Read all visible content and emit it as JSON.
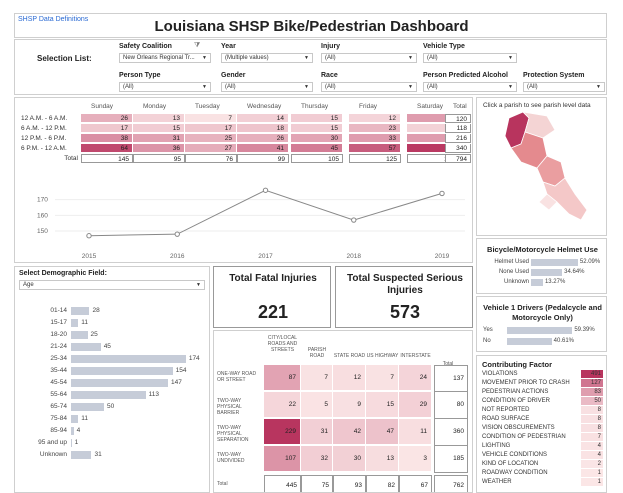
{
  "header": {
    "link": "SHSP Data Definitions",
    "title": "Louisiana SHSP Bike/Pedestrian Dashboard"
  },
  "filters": {
    "selection_label": "Selection List:",
    "safety_coalition": {
      "label": "Safety Coalition",
      "value": "New Orleans Regional Tr..."
    },
    "year": {
      "label": "Year",
      "value": "(Multiple values)"
    },
    "injury": {
      "label": "Injury",
      "value": "(All)"
    },
    "vehicle_type": {
      "label": "Vehicle Type",
      "value": "(All)"
    },
    "person_type": {
      "label": "Person Type",
      "value": "(All)"
    },
    "gender": {
      "label": "Gender",
      "value": "(All)"
    },
    "race": {
      "label": "Race",
      "value": "(All)"
    },
    "alcohol": {
      "label": "Person Predicted Alcohol",
      "value": "(All)"
    },
    "protection": {
      "label": "Protection System",
      "value": "(All)"
    }
  },
  "time_matrix": {
    "columns": [
      "Sunday",
      "Monday",
      "Tuesday",
      "Wednesday",
      "Thursday",
      "Friday",
      "Saturday",
      "Total"
    ],
    "rows": [
      {
        "label": "12 A.M. - 6 A.M.",
        "values": [
          26,
          13,
          7,
          14,
          15,
          12,
          33
        ],
        "total": 120
      },
      {
        "label": "6 A.M. - 12 P.M.",
        "values": [
          17,
          15,
          17,
          18,
          15,
          23,
          13
        ],
        "total": 118
      },
      {
        "label": "12 P.M. - 6 P.M.",
        "values": [
          38,
          31,
          25,
          26,
          30,
          33,
          33
        ],
        "total": 216
      },
      {
        "label": "6 P.M. - 12 A.M.",
        "values": [
          64,
          36,
          27,
          41,
          45,
          57,
          70
        ],
        "total": 340
      }
    ],
    "total_label": "Total",
    "col_totals": [
      145,
      95,
      76,
      99,
      105,
      125,
      149
    ],
    "grand_total": 794
  },
  "chart_data": {
    "type": "line",
    "x": [
      "2015",
      "2016",
      "2017",
      "2018",
      "2019"
    ],
    "y": [
      147,
      148,
      176,
      157,
      174
    ],
    "yticks": [
      150,
      160,
      170
    ],
    "ylim": [
      143,
      180
    ]
  },
  "map": {
    "hint": "Click a parish to see parish level data"
  },
  "helmet": {
    "title": "Bicycle/Motorcycle Helmet Use",
    "rows": [
      {
        "label": "Helmet Used",
        "pct": "52.09%",
        "v": 52.09
      },
      {
        "label": "None Used",
        "pct": "34.64%",
        "v": 34.64
      },
      {
        "label": "Unknown",
        "pct": "13.27%",
        "v": 13.27
      }
    ]
  },
  "drivers": {
    "title": "Vehicle 1 Drivers (Pedalcycle and Motorcycle Only)",
    "rows": [
      {
        "label": "Yes",
        "pct": "59.39%",
        "v": 59.39
      },
      {
        "label": "No",
        "pct": "40.61%",
        "v": 40.61
      }
    ]
  },
  "demographic": {
    "label": "Select Demographic Field:",
    "value": "Age",
    "rows": [
      {
        "label": "01-14",
        "v": 28
      },
      {
        "label": "15-17",
        "v": 11
      },
      {
        "label": "18-20",
        "v": 25
      },
      {
        "label": "21-24",
        "v": 45
      },
      {
        "label": "25-34",
        "v": 174
      },
      {
        "label": "35-44",
        "v": 154
      },
      {
        "label": "45-54",
        "v": 147
      },
      {
        "label": "55-64",
        "v": 113
      },
      {
        "label": "65-74",
        "v": 50
      },
      {
        "label": "75-84",
        "v": 11
      },
      {
        "label": "85-94",
        "v": 4
      },
      {
        "label": "95 and up",
        "v": 1
      },
      {
        "label": "Unknown",
        "v": 31
      }
    ]
  },
  "fatal": {
    "title": "Total Fatal Injuries",
    "value": "221"
  },
  "serious": {
    "title": "Total Suspected Serious Injuries",
    "value": "573"
  },
  "road": {
    "columns": [
      "CITY/LOCAL ROADS AND STREETS",
      "PARISH ROAD",
      "STATE ROAD",
      "US HIGHWAY",
      "INTERSTATE",
      "Total"
    ],
    "rows": [
      {
        "label": "ONE-WAY ROAD OR STREET",
        "values": [
          87,
          7,
          12,
          7,
          24
        ],
        "total": 137
      },
      {
        "label": "TWO-WAY PHYSICAL BARRIER",
        "values": [
          22,
          5,
          9,
          15,
          29
        ],
        "total": 80
      },
      {
        "label": "TWO-WAY PHYSICAL SEPARATION",
        "values": [
          229,
          31,
          42,
          47,
          11
        ],
        "total": 360
      },
      {
        "label": "TWO-WAY UNDIVIDED",
        "values": [
          107,
          32,
          30,
          13,
          3
        ],
        "total": 185
      }
    ],
    "total_label": "Total",
    "col_totals": [
      445,
      75,
      93,
      82,
      67
    ],
    "grand_total": 762
  },
  "factors": {
    "title": "Contributing Factor",
    "rows": [
      {
        "label": "VIOLATIONS",
        "v": 491
      },
      {
        "label": "MOVEMENT PRIOR TO CRASH",
        "v": 127
      },
      {
        "label": "PEDESTRIAN ACTIONS",
        "v": 83
      },
      {
        "label": "CONDITION OF DRIVER",
        "v": 50
      },
      {
        "label": "NOT REPORTED",
        "v": 8
      },
      {
        "label": "ROAD SURFACE",
        "v": 8
      },
      {
        "label": "VISION OBSCUREMENTS",
        "v": 8
      },
      {
        "label": "CONDITION OF PEDESTRIAN",
        "v": 7
      },
      {
        "label": "LIGHTING",
        "v": 4
      },
      {
        "label": "VEHICLE CONDITIONS",
        "v": 4
      },
      {
        "label": "KIND OF LOCATION",
        "v": 2
      },
      {
        "label": "ROADWAY CONDITION",
        "v": 1
      },
      {
        "label": "WEATHER",
        "v": 1
      }
    ]
  },
  "colors": {
    "accent": "#e8b8b8",
    "deep": "#b8345e"
  }
}
